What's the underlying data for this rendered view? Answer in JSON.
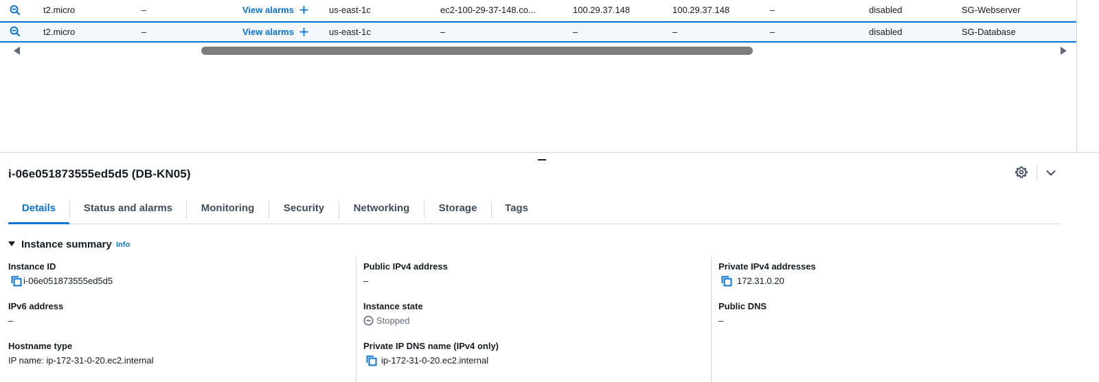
{
  "table": {
    "rows": [
      {
        "instance_type": "t2.micro",
        "status_dash": "–",
        "alarms_label": "View alarms",
        "az": "us-east-1c",
        "public_dns": "ec2-100-29-37-148.co...",
        "public_ipv4": "100.29.37.148",
        "elastic_ip": "100.29.37.148",
        "ipv6": "–",
        "monitoring": "disabled",
        "security_group": "SG-Webserver"
      },
      {
        "instance_type": "t2.micro",
        "status_dash": "–",
        "alarms_label": "View alarms",
        "az": "us-east-1c",
        "public_dns": "–",
        "public_ipv4": "–",
        "elastic_ip": "–",
        "ipv6": "–",
        "monitoring": "disabled",
        "security_group": "SG-Database"
      }
    ]
  },
  "panel": {
    "title": "i-06e051873555ed5d5 (DB-KN05)",
    "tabs": [
      "Details",
      "Status and alarms",
      "Monitoring",
      "Security",
      "Networking",
      "Storage",
      "Tags"
    ],
    "active_tab": "Details",
    "summary": {
      "heading": "Instance summary",
      "info": "Info"
    },
    "fields": {
      "instance_id": {
        "label": "Instance ID",
        "value": "i-06e051873555ed5d5"
      },
      "public_ipv4": {
        "label": "Public IPv4 address",
        "value": "–"
      },
      "private_ipv4": {
        "label": "Private IPv4 addresses",
        "value": "172.31.0.20"
      },
      "ipv6": {
        "label": "IPv6 address",
        "value": "–"
      },
      "instance_state": {
        "label": "Instance state",
        "value": "Stopped"
      },
      "public_dns": {
        "label": "Public DNS",
        "value": "–"
      },
      "hostname_type": {
        "label": "Hostname type",
        "value": "IP name: ip-172-31-0-20.ec2.internal"
      },
      "private_dns": {
        "label": "Private IP DNS name (IPv4 only)",
        "value": "ip-172-31-0-20.ec2.internal"
      }
    }
  },
  "colors": {
    "accent": "#0972d3",
    "text": "#16191f",
    "muted": "#5f6b7a",
    "selected_row_bg": "#f2f8fd"
  },
  "icons": {
    "row_expand": "zoom-out-icon",
    "add": "plus-icon",
    "settings": "gear-icon",
    "collapse": "chevron-down-icon",
    "copy": "copy-icon",
    "state": "stopped-circle-icon"
  }
}
